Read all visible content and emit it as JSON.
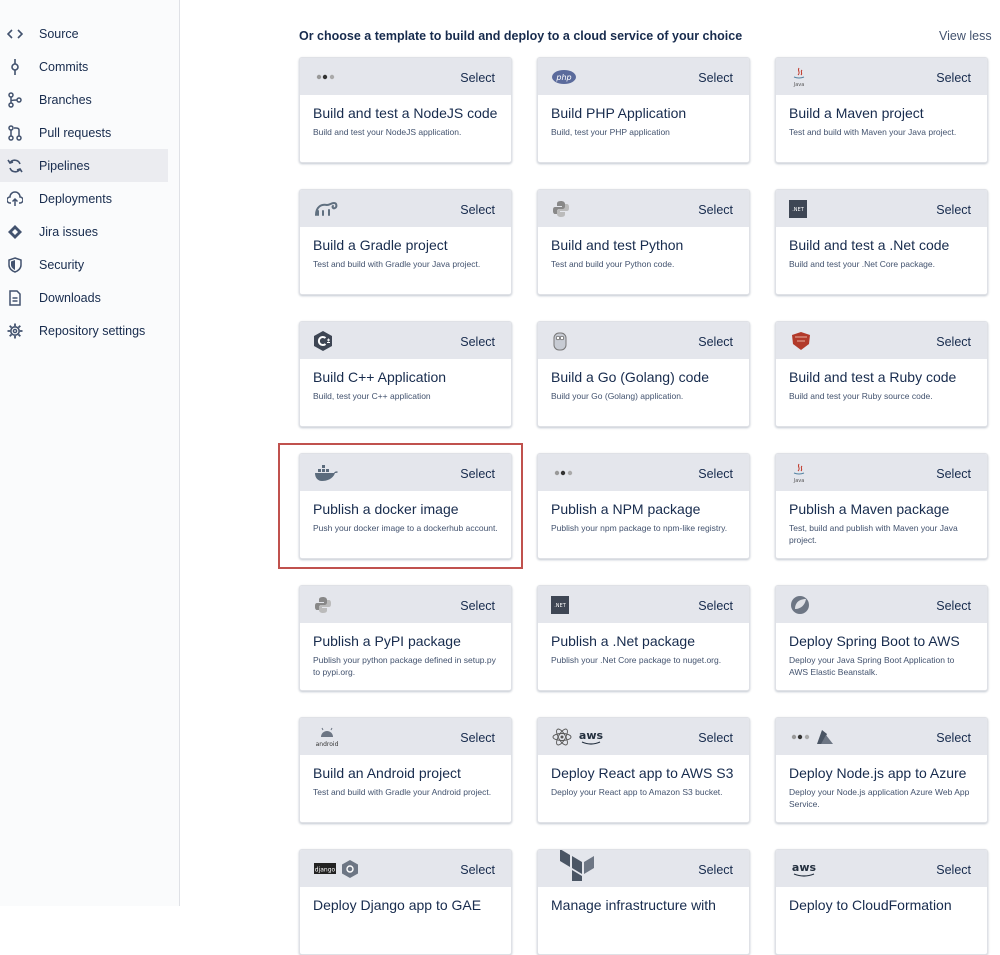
{
  "sidebar": {
    "items": [
      {
        "label": "Source",
        "icon": "code-icon",
        "active": false
      },
      {
        "label": "Commits",
        "icon": "commit-icon",
        "active": false
      },
      {
        "label": "Branches",
        "icon": "branch-icon",
        "active": false
      },
      {
        "label": "Pull requests",
        "icon": "pull-request-icon",
        "active": false
      },
      {
        "label": "Pipelines",
        "icon": "pipelines-icon",
        "active": true
      },
      {
        "label": "Deployments",
        "icon": "cloud-upload-icon",
        "active": false
      },
      {
        "label": "Jira issues",
        "icon": "jira-icon",
        "active": false
      },
      {
        "label": "Security",
        "icon": "shield-icon",
        "active": false
      },
      {
        "label": "Downloads",
        "icon": "document-icon",
        "active": false
      },
      {
        "label": "Repository settings",
        "icon": "gear-icon",
        "active": false
      }
    ]
  },
  "main": {
    "heading": "Or choose a template to build and deploy to a cloud service of your choice",
    "view_less": "View less",
    "select_label": "Select",
    "highlighted_template": "Publish a docker image",
    "templates": [
      {
        "title": "Build and test a NodeJS code",
        "desc": "Build and test your NodeJS application.",
        "logo": "nodejs-icon"
      },
      {
        "title": "Build PHP Application",
        "desc": "Build, test your PHP application",
        "logo": "php-icon",
        "logo_text": "php"
      },
      {
        "title": "Build a Maven project",
        "desc": "Test and build with Maven your Java project.",
        "logo": "java-icon",
        "logo_text": "Java"
      },
      {
        "title": "Build a Gradle project",
        "desc": "Test and build with Gradle your Java project.",
        "logo": "gradle-icon"
      },
      {
        "title": "Build and test Python",
        "desc": "Test and build your Python code.",
        "logo": "python-icon"
      },
      {
        "title": "Build and test a .Net code",
        "desc": "Build and test your .Net Core package.",
        "logo": "dotnet-icon",
        "logo_text": ".NET"
      },
      {
        "title": "Build C++ Application",
        "desc": "Build, test your C++ application",
        "logo": "cpp-icon"
      },
      {
        "title": "Build a Go (Golang) code",
        "desc": "Build your Go (Golang) application.",
        "logo": "golang-icon"
      },
      {
        "title": "Build and test a Ruby code",
        "desc": "Build and test your Ruby source code.",
        "logo": "ruby-icon"
      },
      {
        "title": "Publish a docker image",
        "desc": "Push your docker image to a dockerhub account.",
        "logo": "docker-icon"
      },
      {
        "title": "Publish a NPM package",
        "desc": "Publish your npm package to npm-like registry.",
        "logo": "nodejs-icon"
      },
      {
        "title": "Publish a Maven package",
        "desc": "Test, build and publish with Maven your Java project.",
        "logo": "java-icon",
        "logo_text": "Java"
      },
      {
        "title": "Publish a PyPI package",
        "desc": "Publish your python package defined in setup.py to pypi.org.",
        "logo": "python-icon"
      },
      {
        "title": "Publish a .Net package",
        "desc": "Publish your .Net Core package to nuget.org.",
        "logo": "dotnet-icon",
        "logo_text": ".NET"
      },
      {
        "title": "Deploy Spring Boot to AWS",
        "desc": "Deploy your Java Spring Boot Application to AWS Elastic Beanstalk.",
        "logo": "spring-icon"
      },
      {
        "title": "Build an Android project",
        "desc": "Test and build with Gradle your Android project.",
        "logo": "android-icon",
        "logo_text": "android"
      },
      {
        "title": "Deploy React app to AWS S3",
        "desc": "Deploy your React app to Amazon S3 bucket.",
        "logo": "react-aws-icon",
        "logo_text": "aws"
      },
      {
        "title": "Deploy Node.js app to Azure",
        "desc": "Deploy your Node.js application Azure Web App Service.",
        "logo": "nodejs-azure-icon"
      },
      {
        "title": "Deploy Django app to GAE",
        "desc": "",
        "logo": "django-gcp-icon",
        "logo_text": "django"
      },
      {
        "title": "Manage infrastructure with",
        "desc": "",
        "logo": "terraform-icon"
      },
      {
        "title": "Deploy to CloudFormation",
        "desc": "",
        "logo": "aws-icon",
        "logo_text": "aws"
      }
    ]
  }
}
